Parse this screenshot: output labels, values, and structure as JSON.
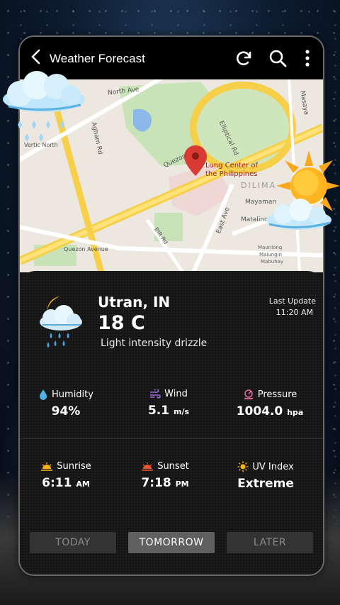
{
  "app": {
    "title": "Weather Forecast"
  },
  "map": {
    "streets": [
      "North Ave",
      "Agham Rd",
      "Quezon",
      "Elliptical Rd",
      "Quezon Avenue",
      "BIR Rd",
      "East Ave",
      "Matalino",
      "Mayaman",
      "Masaya",
      "Maunlong",
      "Malungin",
      "Mabuhay",
      "Vertic North"
    ],
    "place": "Lung Center of\nthe Philippines",
    "district": "DILIMA"
  },
  "current": {
    "city": "Utran, IN",
    "temperature": "18 C",
    "description": "Light intensity drizzle",
    "last_update_label": "Last Update",
    "last_update_time": "11:20 AM"
  },
  "stats": {
    "humidity": {
      "label": "Humidity",
      "value": "94%",
      "icon": "droplet-icon"
    },
    "wind": {
      "label": "Wind",
      "value": "5.1",
      "unit": "m/s",
      "icon": "wind-icon"
    },
    "pressure": {
      "label": "Pressure",
      "value": "1004.0",
      "unit": "hpa",
      "icon": "pressure-icon"
    },
    "sunrise": {
      "label": "Sunrise",
      "value": "6:11",
      "unit": "AM",
      "icon": "sunrise-icon"
    },
    "sunset": {
      "label": "Sunset",
      "value": "7:18",
      "unit": "PM",
      "icon": "sunset-icon"
    },
    "uv": {
      "label": "UV Index",
      "value": "Extreme",
      "icon": "sun-icon"
    }
  },
  "tabs": [
    {
      "label": "TODAY"
    },
    {
      "label": "TOMORROW"
    },
    {
      "label": "LATER"
    }
  ],
  "colors": {
    "accent_blue": "#4fb3e8",
    "wind": "#9b6bd6",
    "pressure": "#e06aa0",
    "sun": "#f7b21a",
    "selected_tab": "#5f5f5f"
  }
}
